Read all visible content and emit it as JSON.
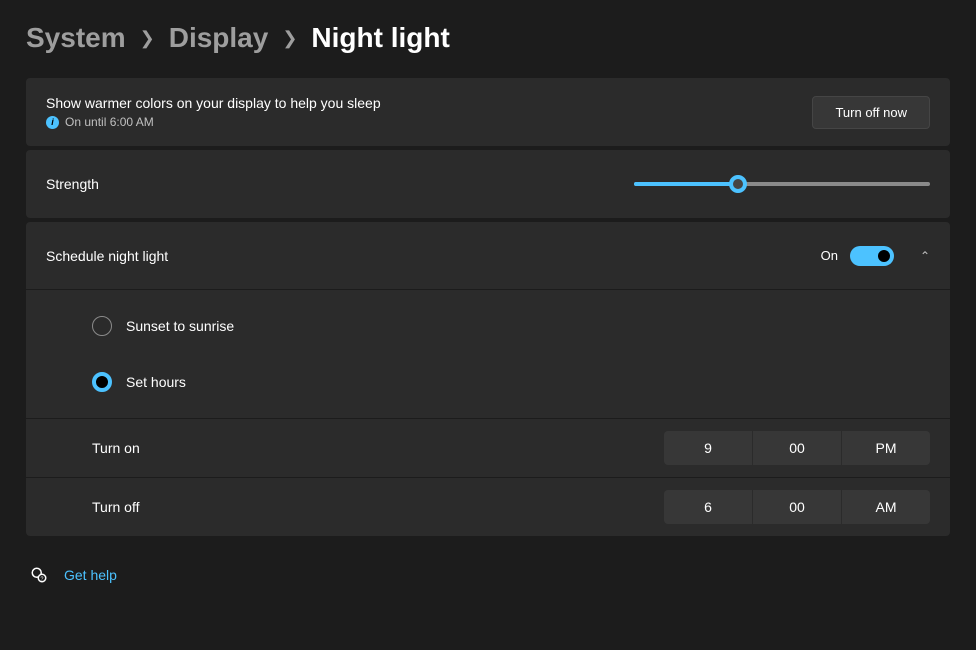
{
  "breadcrumb": {
    "item1": "System",
    "item2": "Display",
    "current": "Night light"
  },
  "description": {
    "title": "Show warmer colors on your display to help you sleep",
    "status": "On until 6:00 AM",
    "button": "Turn off now"
  },
  "strength": {
    "label": "Strength",
    "value_pct": 35
  },
  "schedule": {
    "label": "Schedule night light",
    "toggle_label": "On",
    "toggle_on": true,
    "radio1": "Sunset to sunrise",
    "radio2": "Set hours",
    "turn_on": {
      "label": "Turn on",
      "hour": "9",
      "minute": "00",
      "period": "PM"
    },
    "turn_off": {
      "label": "Turn off",
      "hour": "6",
      "minute": "00",
      "period": "AM"
    }
  },
  "help": {
    "label": "Get help"
  }
}
